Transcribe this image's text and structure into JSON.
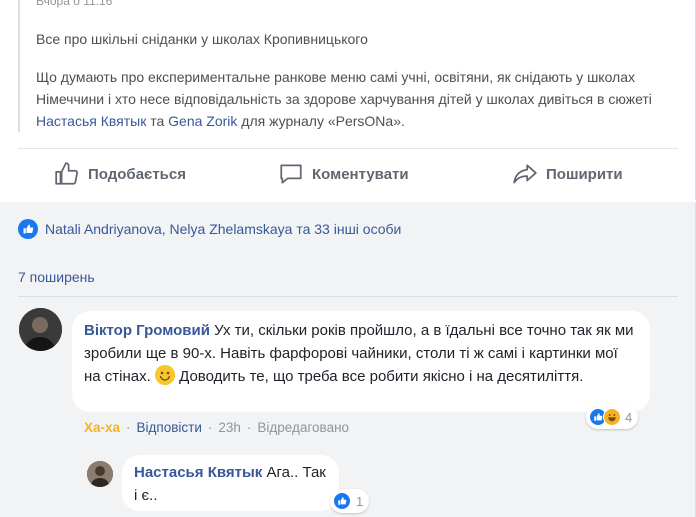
{
  "post": {
    "time_text": "Вчора о 11:16",
    "quote_title": "Все про шкільні сніданки у школах Кропивницького",
    "quote_body_1": "Що думають про експериментальне ранкове меню самі учні, освітяни, як снідають у школах Німеччини і хто несе відповідальність за здорове харчування дітей у школах дивіться в сюжеті ",
    "link_1": "Настасья Квятык",
    "and_text": " та ",
    "link_2": "Gena Zorik",
    "quote_body_2": " для журналу «PersONa»."
  },
  "actions": {
    "like_label": "Подобається",
    "comment_label": "Коментувати",
    "share_label": "Поширити"
  },
  "feedback": {
    "likes_text": "Natali Andriyanova, Nelya Zhelamskaya та 33 інші особи",
    "shares_text": "7 поширень"
  },
  "comments": [
    {
      "author": "Віктор Громовий",
      "text_1": " Ух ти, скільки років пройшло, а в їдальні все точно так як ми зробили ще в 90-х. Навіть фарфорові чайники, столи ті ж самі і картинки мої на стінах. ",
      "text_2": " Доводить те, що треба все робити якісно і на десятиліття.",
      "reaction_label": "Ха-ха",
      "reply_label": "Відповісти",
      "age": "23h",
      "edited": "Відредаговано",
      "reaction_count": "4"
    }
  ],
  "reply": {
    "author": "Настасья Квятык",
    "text": " Ага.. Так і є..",
    "reaction_count": "1"
  },
  "colors": {
    "link": "#385898",
    "like_blue": "#1877f2",
    "haha_yellow": "#f7b125",
    "feedback_bg": "#f2f3f5"
  }
}
